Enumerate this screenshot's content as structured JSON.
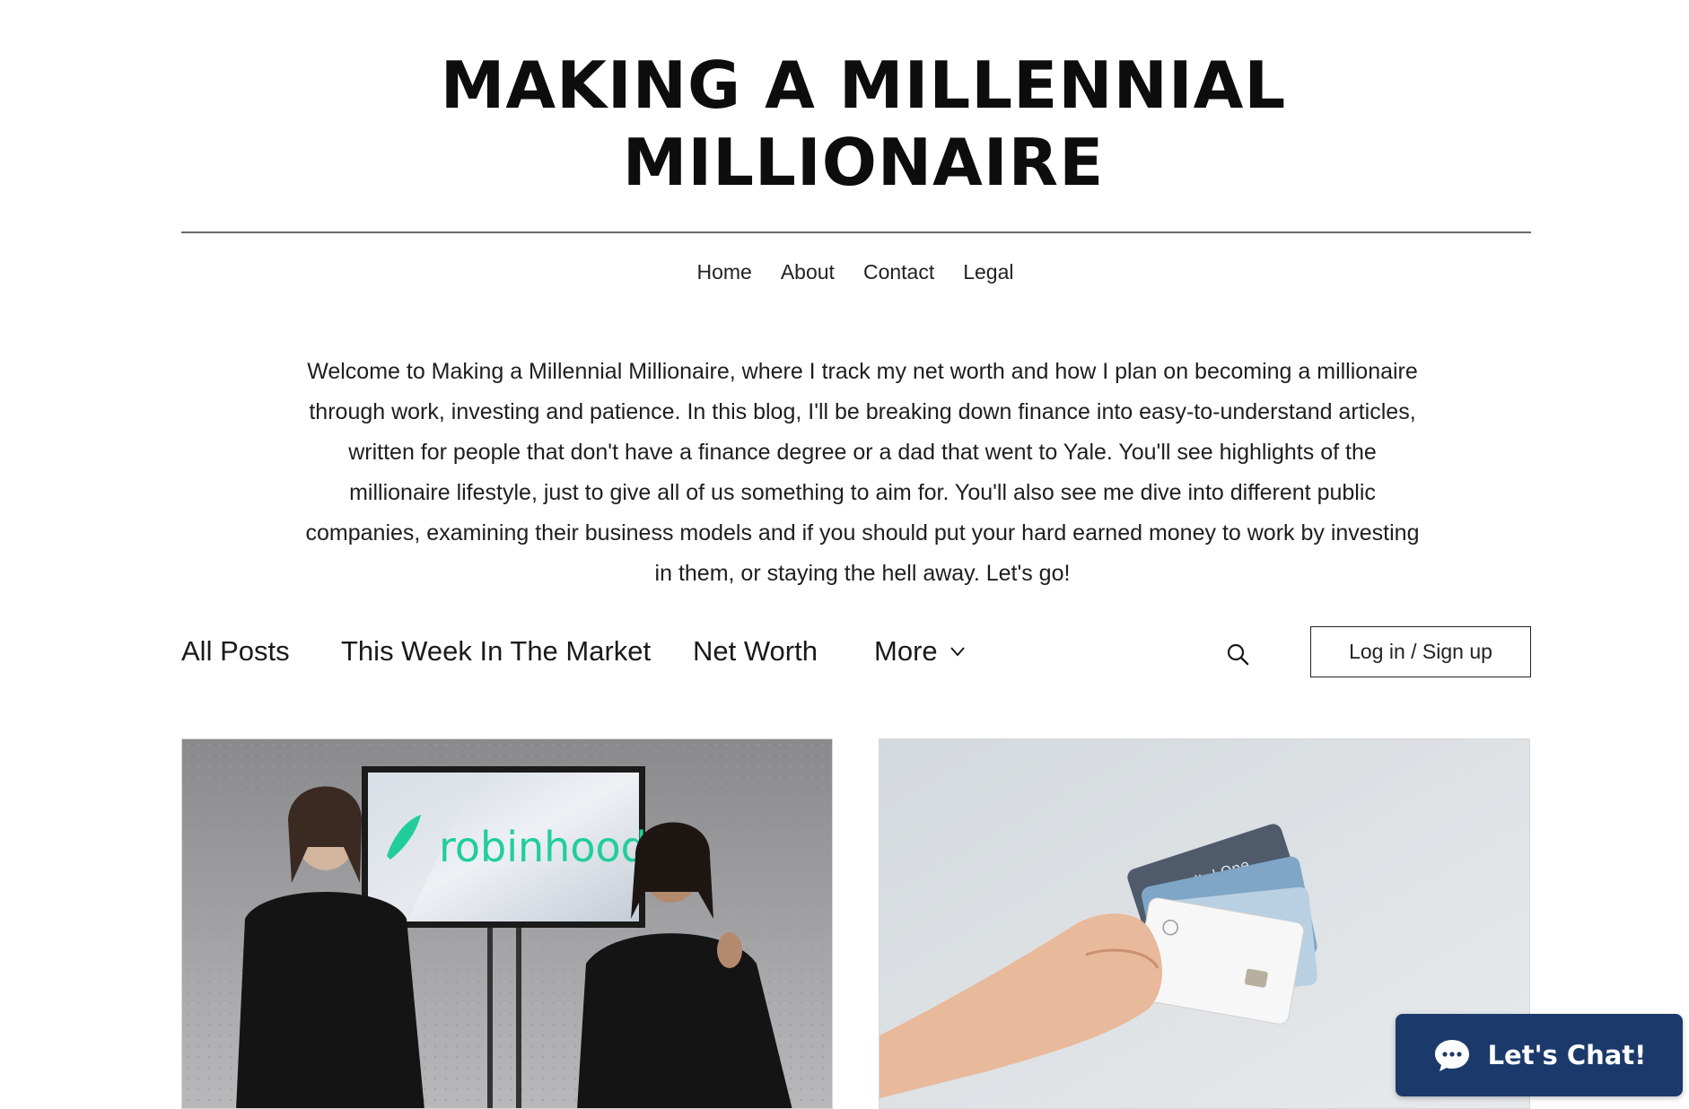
{
  "site": {
    "title_line1": "MAKING A MILLENNIAL",
    "title_line2": "MILLIONAIRE"
  },
  "nav": {
    "items": [
      {
        "label": "Home"
      },
      {
        "label": "About"
      },
      {
        "label": "Contact"
      },
      {
        "label": "Legal"
      }
    ]
  },
  "intro": {
    "text": "Welcome to Making a Millennial Millionaire, where I track my net worth and how I plan on becoming a millionaire through work, investing and patience. In this blog, I'll be breaking down finance into easy-to-understand articles, written for people that don't have a finance degree or a dad that went to Yale. You'll see highlights of the millionaire lifestyle, just to give all of us something to aim for. You'll also see me dive into different public companies, examining their business models and if you should put your hard earned money to work by investing in them, or staying the hell away. Let's go!"
  },
  "blog_bar": {
    "categories": [
      {
        "label": "All Posts"
      },
      {
        "label": "This Week In The Market"
      },
      {
        "label": "Net Worth"
      },
      {
        "label": "More"
      }
    ],
    "search_icon": "search-icon",
    "more_icon": "chevron-down-icon",
    "login_label": "Log in / Sign up"
  },
  "posts": [
    {
      "image_text": "robinhood",
      "image_subject": "two men seated in front of a screen"
    },
    {
      "image_text": "Capital One",
      "image_subject": "hand holding credit cards"
    }
  ],
  "chat": {
    "label": "Let's Chat!",
    "icon": "chat-bubble-icon",
    "color": "#1b3a6b"
  }
}
